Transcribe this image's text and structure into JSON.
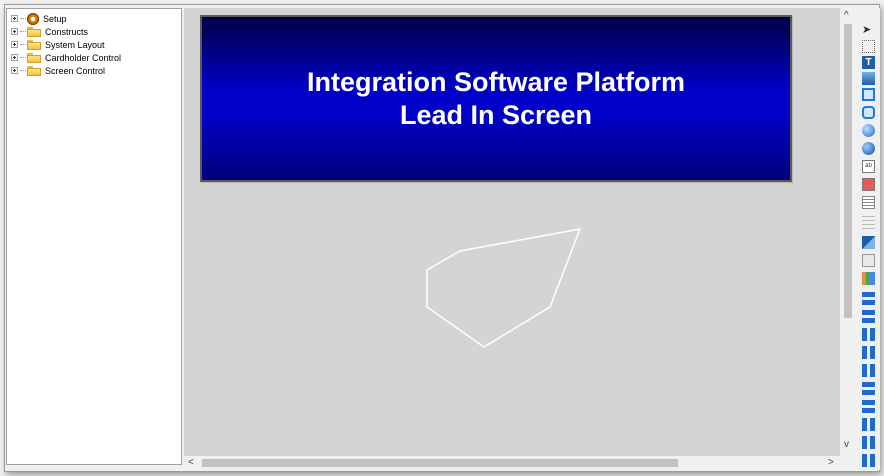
{
  "tree": {
    "items": [
      {
        "label": "Setup",
        "icon": "gear-icon"
      },
      {
        "label": "Constructs",
        "icon": "folder-icon"
      },
      {
        "label": "System Layout",
        "icon": "folder-icon"
      },
      {
        "label": "Cardholder Control",
        "icon": "folder-icon"
      },
      {
        "label": "Screen Control",
        "icon": "folder-icon"
      }
    ]
  },
  "banner": {
    "line1": "Integration Software Platform",
    "line2": "Lead In Screen"
  },
  "scroll": {
    "up": "^",
    "down": "v",
    "left": "<",
    "right": ">"
  },
  "toolbox": {
    "tools": [
      "pointer-tool-icon",
      "selection-tool-icon",
      "text-tool-icon",
      "filled-rectangle-tool-icon",
      "rectangle-tool-icon",
      "rounded-rectangle-tool-icon",
      "ellipse-tool-icon",
      "shaded-circle-tool-icon",
      "text-box-tool-icon",
      "button-tool-icon",
      "grid-tool-icon",
      "list-tool-icon",
      "image-tool-icon",
      "picture-frame-tool-icon",
      "palette-tool-icon",
      "align-left-icon",
      "align-right-icon",
      "align-top-icon",
      "align-bottom-icon",
      "align-center-icon",
      "distribute-horizontal-icon",
      "distribute-vertical-icon",
      "same-width-icon",
      "same-height-icon",
      "same-size-icon"
    ]
  },
  "colors": {
    "banner_top": "#000046",
    "banner_mid": "#0000c8",
    "canvas": "#d4d4d4",
    "polygon_stroke": "#ffffff"
  }
}
